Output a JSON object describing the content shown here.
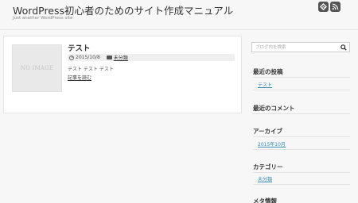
{
  "header": {
    "title": "WordPress初心者のためのサイト作成マニュアル",
    "description": "Just another WordPress site",
    "icons": [
      "feedly-icon",
      "rss-icon"
    ]
  },
  "post": {
    "thumbnail_text": "NO IMAGE",
    "title": "テスト",
    "date": "2015/10/8",
    "category": "未分類",
    "excerpt": "テスト テスト テスト",
    "read_more": "記事を読む"
  },
  "sidebar": {
    "search_placeholder": "ブログ内を検索",
    "recent_posts": {
      "title": "最近の投稿",
      "items": [
        "テスト"
      ]
    },
    "recent_comments": {
      "title": "最近のコメント"
    },
    "archives": {
      "title": "アーカイブ",
      "items": [
        "2015年10月"
      ]
    },
    "categories": {
      "title": "カテゴリー",
      "items": [
        "未分類"
      ]
    },
    "meta": {
      "title": "メタ情報"
    }
  },
  "colors": {
    "background": "#f7f7f7",
    "card": "#ffffff",
    "link": "#3a8fb7",
    "icon": "#555555"
  }
}
